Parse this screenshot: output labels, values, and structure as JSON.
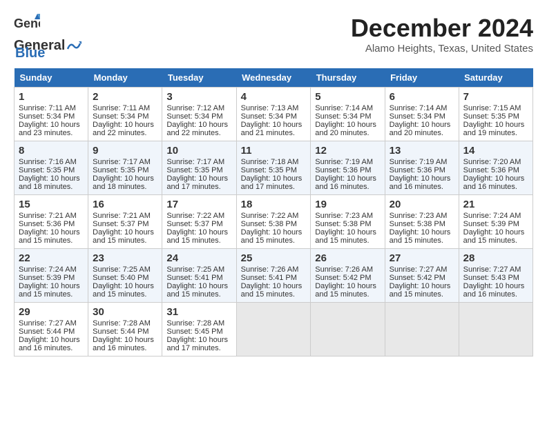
{
  "logo": {
    "general": "General",
    "blue": "Blue"
  },
  "header": {
    "month": "December 2024",
    "location": "Alamo Heights, Texas, United States"
  },
  "days_of_week": [
    "Sunday",
    "Monday",
    "Tuesday",
    "Wednesday",
    "Thursday",
    "Friday",
    "Saturday"
  ],
  "weeks": [
    [
      {
        "day": "1",
        "sunrise": "7:11 AM",
        "sunset": "5:34 PM",
        "daylight": "10 hours and 23 minutes."
      },
      {
        "day": "2",
        "sunrise": "7:11 AM",
        "sunset": "5:34 PM",
        "daylight": "10 hours and 22 minutes."
      },
      {
        "day": "3",
        "sunrise": "7:12 AM",
        "sunset": "5:34 PM",
        "daylight": "10 hours and 22 minutes."
      },
      {
        "day": "4",
        "sunrise": "7:13 AM",
        "sunset": "5:34 PM",
        "daylight": "10 hours and 21 minutes."
      },
      {
        "day": "5",
        "sunrise": "7:14 AM",
        "sunset": "5:34 PM",
        "daylight": "10 hours and 20 minutes."
      },
      {
        "day": "6",
        "sunrise": "7:14 AM",
        "sunset": "5:34 PM",
        "daylight": "10 hours and 20 minutes."
      },
      {
        "day": "7",
        "sunrise": "7:15 AM",
        "sunset": "5:35 PM",
        "daylight": "10 hours and 19 minutes."
      }
    ],
    [
      {
        "day": "8",
        "sunrise": "7:16 AM",
        "sunset": "5:35 PM",
        "daylight": "10 hours and 18 minutes."
      },
      {
        "day": "9",
        "sunrise": "7:17 AM",
        "sunset": "5:35 PM",
        "daylight": "10 hours and 18 minutes."
      },
      {
        "day": "10",
        "sunrise": "7:17 AM",
        "sunset": "5:35 PM",
        "daylight": "10 hours and 17 minutes."
      },
      {
        "day": "11",
        "sunrise": "7:18 AM",
        "sunset": "5:35 PM",
        "daylight": "10 hours and 17 minutes."
      },
      {
        "day": "12",
        "sunrise": "7:19 AM",
        "sunset": "5:36 PM",
        "daylight": "10 hours and 16 minutes."
      },
      {
        "day": "13",
        "sunrise": "7:19 AM",
        "sunset": "5:36 PM",
        "daylight": "10 hours and 16 minutes."
      },
      {
        "day": "14",
        "sunrise": "7:20 AM",
        "sunset": "5:36 PM",
        "daylight": "10 hours and 16 minutes."
      }
    ],
    [
      {
        "day": "15",
        "sunrise": "7:21 AM",
        "sunset": "5:36 PM",
        "daylight": "10 hours and 15 minutes."
      },
      {
        "day": "16",
        "sunrise": "7:21 AM",
        "sunset": "5:37 PM",
        "daylight": "10 hours and 15 minutes."
      },
      {
        "day": "17",
        "sunrise": "7:22 AM",
        "sunset": "5:37 PM",
        "daylight": "10 hours and 15 minutes."
      },
      {
        "day": "18",
        "sunrise": "7:22 AM",
        "sunset": "5:38 PM",
        "daylight": "10 hours and 15 minutes."
      },
      {
        "day": "19",
        "sunrise": "7:23 AM",
        "sunset": "5:38 PM",
        "daylight": "10 hours and 15 minutes."
      },
      {
        "day": "20",
        "sunrise": "7:23 AM",
        "sunset": "5:38 PM",
        "daylight": "10 hours and 15 minutes."
      },
      {
        "day": "21",
        "sunrise": "7:24 AM",
        "sunset": "5:39 PM",
        "daylight": "10 hours and 15 minutes."
      }
    ],
    [
      {
        "day": "22",
        "sunrise": "7:24 AM",
        "sunset": "5:39 PM",
        "daylight": "10 hours and 15 minutes."
      },
      {
        "day": "23",
        "sunrise": "7:25 AM",
        "sunset": "5:40 PM",
        "daylight": "10 hours and 15 minutes."
      },
      {
        "day": "24",
        "sunrise": "7:25 AM",
        "sunset": "5:41 PM",
        "daylight": "10 hours and 15 minutes."
      },
      {
        "day": "25",
        "sunrise": "7:26 AM",
        "sunset": "5:41 PM",
        "daylight": "10 hours and 15 minutes."
      },
      {
        "day": "26",
        "sunrise": "7:26 AM",
        "sunset": "5:42 PM",
        "daylight": "10 hours and 15 minutes."
      },
      {
        "day": "27",
        "sunrise": "7:27 AM",
        "sunset": "5:42 PM",
        "daylight": "10 hours and 15 minutes."
      },
      {
        "day": "28",
        "sunrise": "7:27 AM",
        "sunset": "5:43 PM",
        "daylight": "10 hours and 16 minutes."
      }
    ],
    [
      {
        "day": "29",
        "sunrise": "7:27 AM",
        "sunset": "5:44 PM",
        "daylight": "10 hours and 16 minutes."
      },
      {
        "day": "30",
        "sunrise": "7:28 AM",
        "sunset": "5:44 PM",
        "daylight": "10 hours and 16 minutes."
      },
      {
        "day": "31",
        "sunrise": "7:28 AM",
        "sunset": "5:45 PM",
        "daylight": "10 hours and 17 minutes."
      },
      null,
      null,
      null,
      null
    ]
  ],
  "labels": {
    "sunrise": "Sunrise:",
    "sunset": "Sunset:",
    "daylight": "Daylight:"
  }
}
